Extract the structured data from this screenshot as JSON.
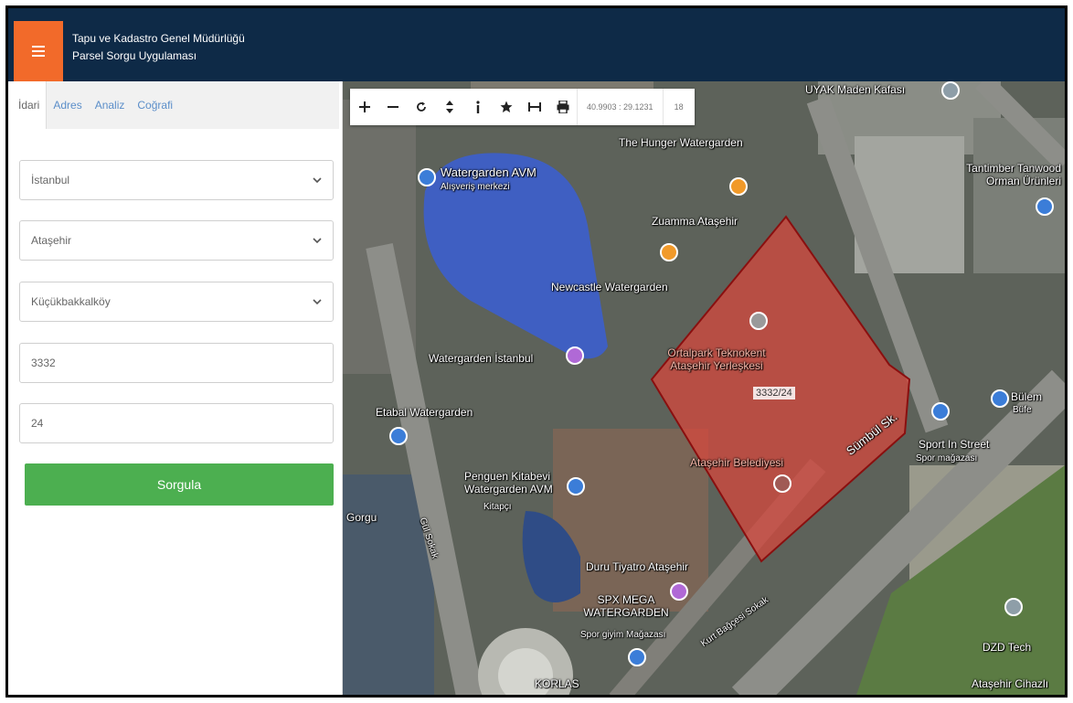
{
  "header": {
    "title_line1": "Tapu ve Kadastro Genel Müdürlüğü",
    "title_line2": "Parsel Sorgu Uygulaması"
  },
  "tabs": [
    {
      "label": "İdari"
    },
    {
      "label": "Adres"
    },
    {
      "label": "Analiz"
    },
    {
      "label": "Coğrafi"
    }
  ],
  "form": {
    "province": "İstanbul",
    "district": "Ataşehir",
    "neighborhood": "Küçükbakkalköy",
    "block": "3332",
    "parcel": "24",
    "submit_label": "Sorgula"
  },
  "map": {
    "coordinates": "40.9903 : 29.1231",
    "zoom_level": "18",
    "parcel_label": "3332/24",
    "places": [
      {
        "name": "UYAK Maden Kafası"
      },
      {
        "name": "The Hunger Watergarden"
      },
      {
        "name": "Watergarden AVM"
      },
      {
        "name": "Alışveriş merkezi"
      },
      {
        "name": "Zuamma Ataşehir"
      },
      {
        "name": "Newcastle Watergarden"
      },
      {
        "name": "Watergarden İstanbul"
      },
      {
        "name": "Ortalpark Teknokent Ataşehir Yerleşkesi"
      },
      {
        "name": "Ataşehir Belediyesi"
      },
      {
        "name": "Etabal Watergarden"
      },
      {
        "name": "Penguen Kitabevi Watergarden AVM"
      },
      {
        "name": "Kitapçı"
      },
      {
        "name": "Duru Tiyatro Ataşehir"
      },
      {
        "name": "SPX MEGA WATERGARDEN"
      },
      {
        "name": "Spor giyim Mağazası"
      },
      {
        "name": "KORLAS"
      },
      {
        "name": "Tantimber Tanwood Orman Ürünleri"
      },
      {
        "name": "Bülem"
      },
      {
        "name": "Büfe"
      },
      {
        "name": "Sport In Street"
      },
      {
        "name": "Spor mağazası"
      },
      {
        "name": "DZD Tech"
      },
      {
        "name": "Ataşehir Cihazlı"
      },
      {
        "name": "Sümbül Sk."
      },
      {
        "name": "Kurt Bağçesi Sokak"
      },
      {
        "name": "Gül Sokak"
      },
      {
        "name": "Gorgu"
      }
    ]
  },
  "colors": {
    "header_bg": "#0e2a47",
    "menu_accent": "#f26a2a",
    "submit_button": "#4caf50",
    "parcel_fill": "#d9463c"
  }
}
